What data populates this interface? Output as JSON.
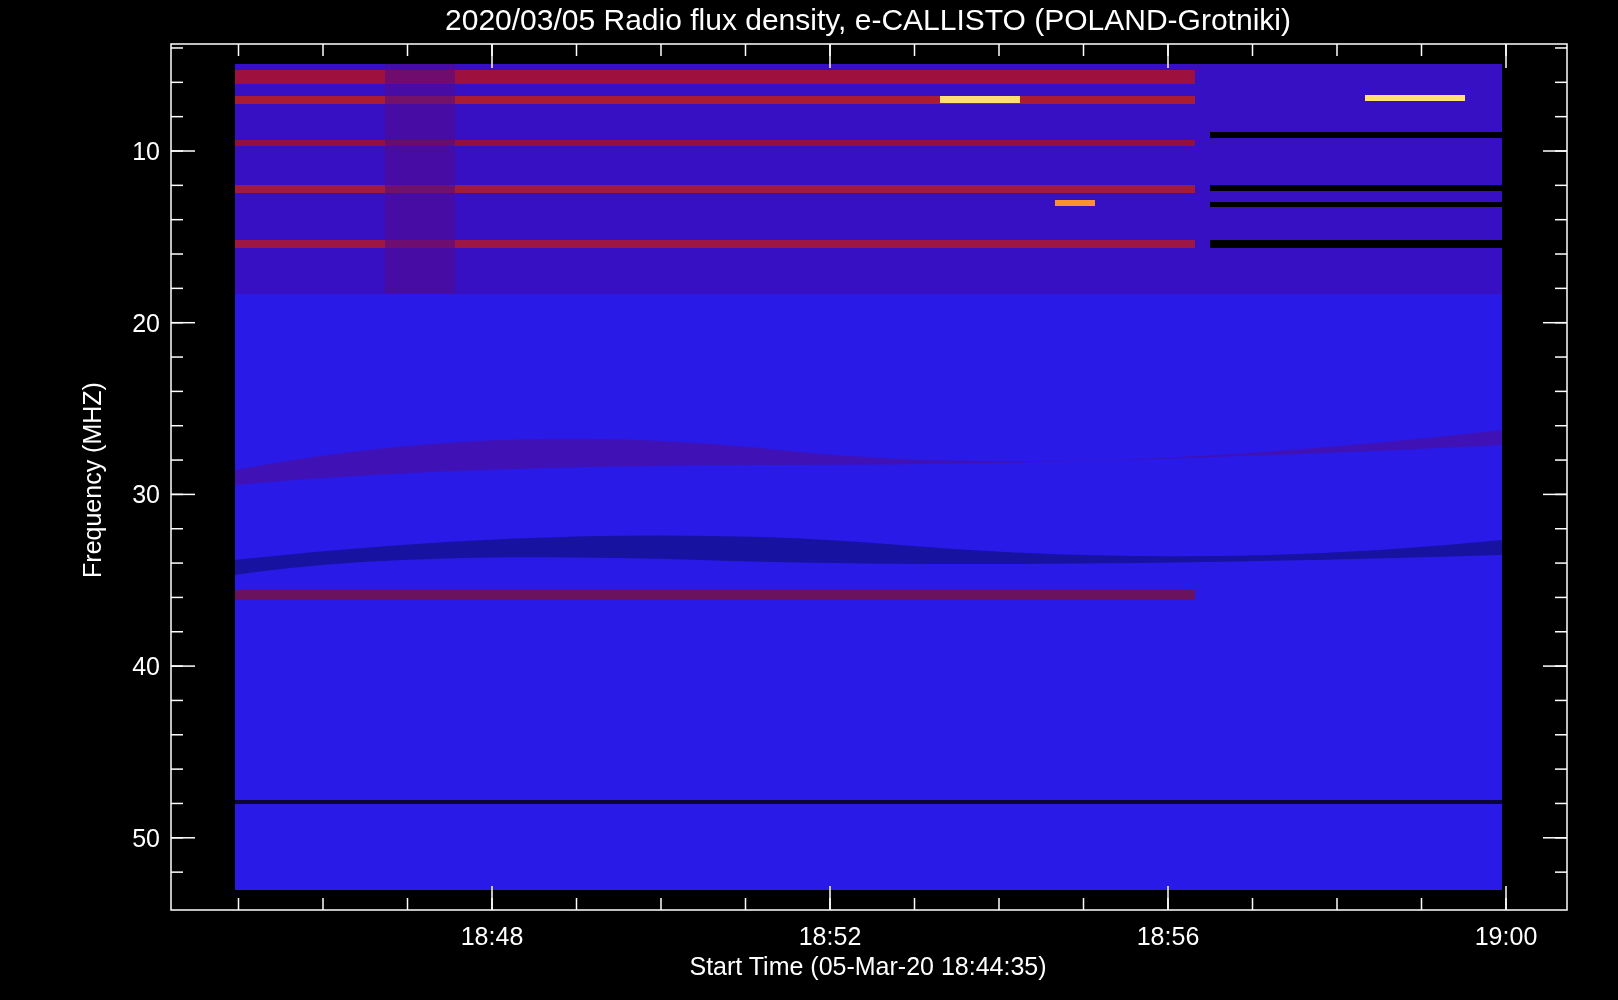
{
  "title": "2020/03/05  Radio flux density, e-CALLISTO (POLAND-Grotniki)",
  "y_axis": {
    "label": "Frequency (MHZ)",
    "ticks": [
      "10",
      "20",
      "30",
      "40",
      "50"
    ]
  },
  "x_axis": {
    "label": "Start Time (05-Mar-20 18:44:35)",
    "ticks": [
      "18:48",
      "18:52",
      "18:56",
      "19:00"
    ]
  }
}
